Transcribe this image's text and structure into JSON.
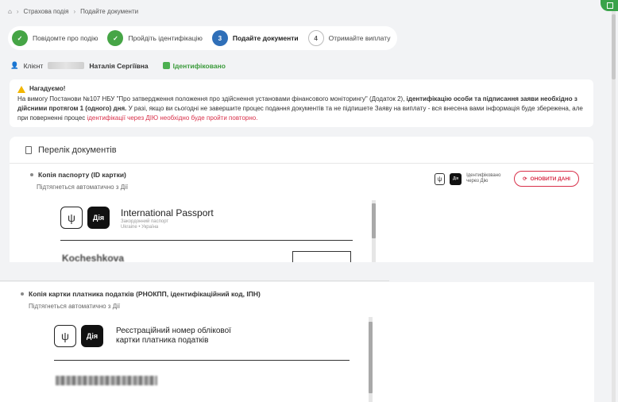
{
  "breadcrumb": {
    "home_icon": "home-icon",
    "item1": "Страхова подія",
    "item2": "Подайте документи",
    "separator": "›"
  },
  "stepper": [
    {
      "number": "✓",
      "label": "Повідомте про подію",
      "state": "done"
    },
    {
      "number": "✓",
      "label": "Пройдіть ідентифікацію",
      "state": "done"
    },
    {
      "number": "3",
      "label": "Подайте документи",
      "state": "active"
    },
    {
      "number": "4",
      "label": "Отримайте виплату",
      "state": "pending"
    }
  ],
  "client": {
    "prefix": "Клієнт",
    "name": "Наталія Сергіївна",
    "status": "Ідентифіковано"
  },
  "notice": {
    "title": "Нагадуємо!",
    "text_a": "На вимогу Постанови №107 НБУ \"Про затвердження положення про здійснення установами фінансового моніторингу\" (Додаток 2), ",
    "bold_a": "ідентифікацію особи та підписання заяви необхідно з дійсними протягом 1 (одного) дня.",
    "text_b": " У разі, якщо ви сьогодні не завершите процес подання документів та не підпишете Заяву на виплату - вся внесена вами інформація буде збережена, але при поверненні процес ",
    "red": "ідентифікації через ДІЮ необхідно буде пройти повторно."
  },
  "documents": {
    "heading": "Перелік документів",
    "passport": {
      "title": "Копія паспорту (ID картки)",
      "subtitle": "Підтягнеться автоматично з Дії",
      "status": "Ідентифіковано через Дію",
      "refresh_label": "ОНОВИТИ ДАНІ",
      "preview_brand": "Дія",
      "preview_title": "International Passport",
      "preview_sub1": "Закордонний паспорт",
      "preview_sub2": "Ukraine • Україна",
      "preview_name": "Kocheshkova"
    },
    "tax": {
      "title": "Копія картки платника податків (РНОКПП, ідентифікаційний код, ІПН)",
      "subtitle": "Підтягнеться автоматично з Дії",
      "preview_brand": "Дія",
      "preview_title_1": "Реєстраційний номер облікової",
      "preview_title_2": "картки платника податків"
    }
  }
}
